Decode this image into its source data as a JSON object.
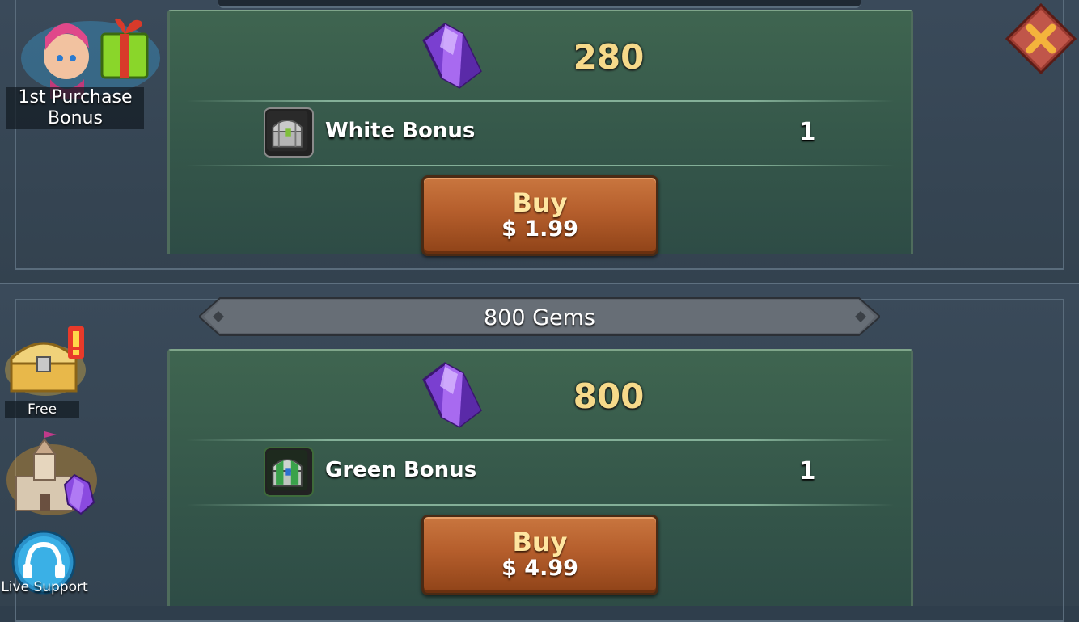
{
  "sidebar": {
    "first_purchase_label": "1st Purchase Bonus",
    "free_label": "Free",
    "live_support_label": "Live Support"
  },
  "packages": [
    {
      "gems": "280",
      "bonus_name": "White Bonus",
      "bonus_count": "1",
      "buy_label": "Buy",
      "price": "$ 1.99"
    },
    {
      "banner": "800 Gems",
      "gems": "800",
      "bonus_name": "Green Bonus",
      "bonus_count": "1",
      "buy_label": "Buy",
      "price": "$ 4.99"
    }
  ],
  "icons": {
    "gem": "purple-gem-icon",
    "white_chest": "white-chest-icon",
    "green_chest": "green-chest-icon",
    "close": "close-icon"
  },
  "colors": {
    "gem_amount": "#f6d98a",
    "buy_button": "#b55e2c",
    "card_green": "#3f6550",
    "close_button": "#b84a3f"
  }
}
